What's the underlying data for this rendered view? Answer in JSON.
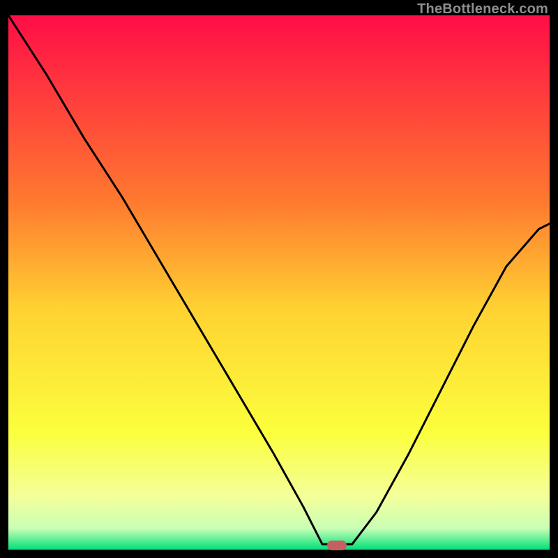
{
  "watermark": "TheBottleneck.com",
  "colors": {
    "gradient_top": "#ff0d47",
    "gradient_mid1": "#ff7a2f",
    "gradient_mid2": "#ffd232",
    "gradient_mid3": "#fbff3c",
    "gradient_mid4": "#f4ff9a",
    "gradient_mid5": "#c9ffb5",
    "gradient_bottom": "#00e07a",
    "curve": "#000000",
    "marker": "#c46060",
    "frame_bg": "#000000"
  },
  "marker": {
    "x_frac": 0.607,
    "y_frac": 0.992
  },
  "chart_data": {
    "type": "line",
    "title": "",
    "xlabel": "",
    "ylabel": "",
    "xlim": [
      0,
      1
    ],
    "ylim": [
      0,
      1
    ],
    "notes": "Axes unlabeled; x and y are normalized fractions of the plot area (0=left/bottom, 1=right/top). The curve dips to a minimum near x≈0.6 then rises again.",
    "series": [
      {
        "name": "bottleneck-curve",
        "x": [
          0.0,
          0.07,
          0.14,
          0.21,
          0.28,
          0.35,
          0.42,
          0.49,
          0.545,
          0.58,
          0.635,
          0.68,
          0.74,
          0.8,
          0.86,
          0.92,
          0.98,
          1.0
        ],
        "y": [
          1.0,
          0.89,
          0.77,
          0.66,
          0.54,
          0.42,
          0.3,
          0.18,
          0.08,
          0.01,
          0.01,
          0.07,
          0.18,
          0.3,
          0.42,
          0.53,
          0.6,
          0.61
        ]
      }
    ]
  }
}
